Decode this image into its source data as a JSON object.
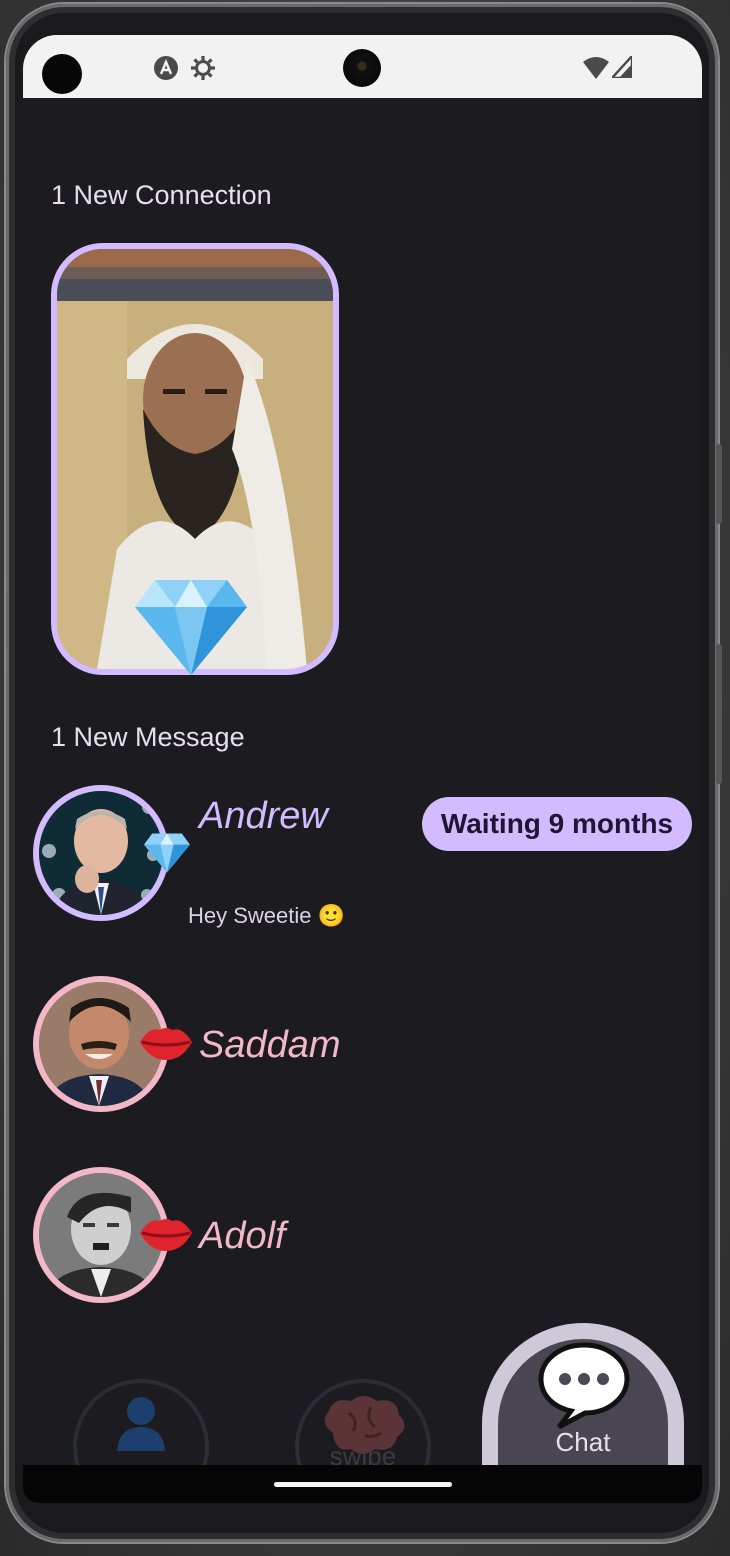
{
  "status_bar": {
    "icons": [
      "record-dot",
      "app-a-icon",
      "settings-icon",
      "front-camera",
      "wifi-icon",
      "signal-icon"
    ]
  },
  "connections": {
    "heading": "1 New Connection",
    "badge_icon": "diamond-icon"
  },
  "messages": {
    "heading": "1 New Message",
    "items": [
      {
        "name": "Andrew",
        "badge_icon": "diamond-icon",
        "preview": "Hey Sweetie 🙂",
        "status": "Waiting 9 months",
        "accent": "#d2bcff"
      },
      {
        "name": "Saddam",
        "badge_icon": "lips-icon",
        "preview": "",
        "status": "",
        "accent": "#f2b8c8"
      },
      {
        "name": "Adolf",
        "badge_icon": "lips-icon",
        "preview": "",
        "status": "",
        "accent": "#f2b8c8"
      }
    ]
  },
  "navbar": {
    "tabs": [
      {
        "label": "",
        "icon": "profile-icon",
        "active": false
      },
      {
        "label": "swipe",
        "icon": "brain-icon",
        "active": false
      },
      {
        "label": "Chat",
        "icon": "chat-bubble-icon",
        "active": true
      }
    ]
  },
  "colors": {
    "background": "#1c1b20",
    "accent_purple": "#d2bcff",
    "accent_pink": "#f2b8c8"
  }
}
